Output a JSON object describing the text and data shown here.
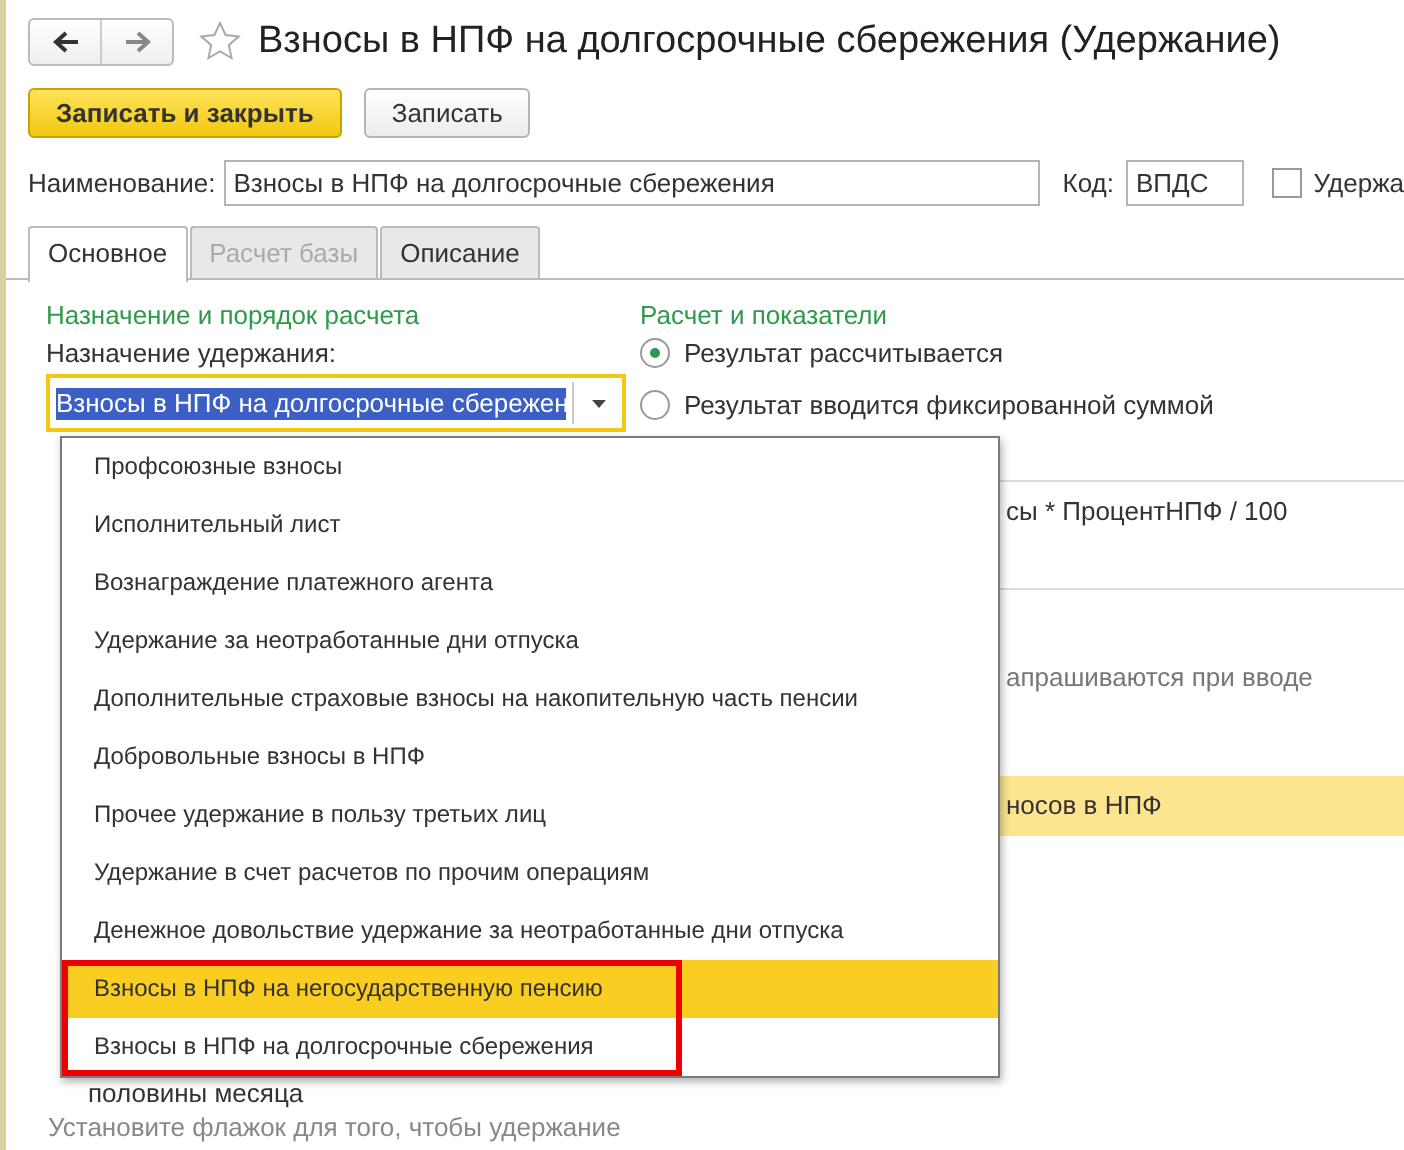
{
  "window": {
    "title": "Взносы в НПФ на долгосрочные сбережения (Удержание)"
  },
  "buttons": [
    {
      "label": "Записать и закрыть",
      "kind": "primary"
    },
    {
      "label": "Записать",
      "kind": "normal"
    }
  ],
  "name_field": {
    "label": "Наименование:",
    "value": "Взносы в НПФ на долгосрочные сбережения"
  },
  "code_field": {
    "label": "Код:",
    "value": "ВПДС"
  },
  "checkbox": {
    "label": "Удержа",
    "checked": false
  },
  "tabs": [
    {
      "label": "Основное",
      "selected": true,
      "disabled": false
    },
    {
      "label": "Расчет базы",
      "selected": false,
      "disabled": true
    },
    {
      "label": "Описание",
      "selected": false,
      "disabled": false
    }
  ],
  "left": {
    "heading": "Назначение и порядок расчета",
    "purpose_label": "Назначение удержания:",
    "purpose_value": "Взносы в НПФ на долгосрочные сбережен"
  },
  "right": {
    "heading": "Расчет и показатели",
    "radios": [
      {
        "label": "Результат рассчитывается",
        "selected": true
      },
      {
        "label": "Результат вводится фиксированной суммой",
        "selected": false
      }
    ],
    "formula": "сы * ПроцентНПФ / 100",
    "hint": "апрашиваются при вводе",
    "highlight_row": "носов в НПФ"
  },
  "dropdown": {
    "items": [
      {
        "label": "Профсоюзные взносы",
        "selected": false,
        "framed": false
      },
      {
        "label": "Исполнительный лист",
        "selected": false,
        "framed": false
      },
      {
        "label": "Вознаграждение платежного агента",
        "selected": false,
        "framed": false
      },
      {
        "label": "Удержание за неотработанные дни отпуска",
        "selected": false,
        "framed": false
      },
      {
        "label": "Дополнительные страховые взносы на накопительную часть пенсии",
        "selected": false,
        "framed": false
      },
      {
        "label": "Добровольные взносы в НПФ",
        "selected": false,
        "framed": false
      },
      {
        "label": "Прочее удержание в пользу третьих лиц",
        "selected": false,
        "framed": false
      },
      {
        "label": "Удержание в счет расчетов по прочим операциям",
        "selected": false,
        "framed": false
      },
      {
        "label": "Денежное довольствие удержание за неотработанные дни отпуска",
        "selected": false,
        "framed": false
      },
      {
        "label": "Взносы в НПФ на негосударственную пенсию",
        "selected": true,
        "framed": true
      },
      {
        "label": "Взносы в НПФ на долгосрочные сбережения",
        "selected": false,
        "framed": true
      }
    ]
  },
  "bottom": {
    "partial_label": "половины месяца",
    "note": "Установите флажок для того, чтобы удержание"
  }
}
